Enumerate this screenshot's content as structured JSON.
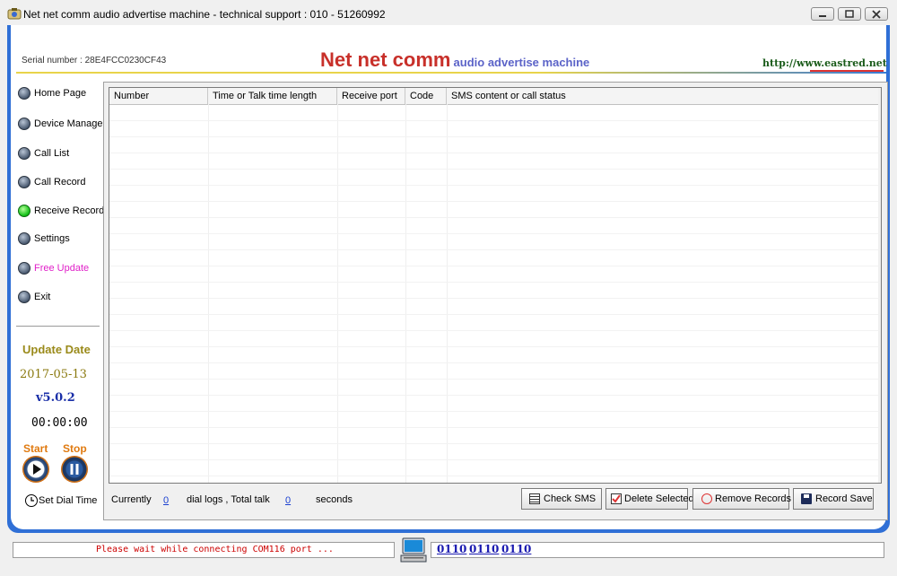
{
  "window": {
    "title": "Net net comm audio advertise machine - technical support : 010 - 51260992",
    "icons": [
      "app-icon",
      "minimize-icon",
      "maximize-icon",
      "close-icon"
    ]
  },
  "header": {
    "serial": "Serial number : 28E4FCC0230CF43",
    "brand_main": "Net net comm",
    "brand_sub": "audio advertise machine",
    "url": "http://www.eastred.net"
  },
  "sidebar": {
    "items": [
      {
        "label": "Home Page",
        "active": false
      },
      {
        "label": "Device Manager",
        "active": false
      },
      {
        "label": "Call List",
        "active": false
      },
      {
        "label": "Call Record",
        "active": false
      },
      {
        "label": "Receive Record",
        "active": true
      },
      {
        "label": "Settings",
        "active": false
      },
      {
        "label": "Free Update",
        "active": false
      },
      {
        "label": "Exit",
        "active": false
      }
    ],
    "update_label": "Update Date",
    "update_date": "2017-05-13",
    "version": "v5.0.2",
    "timer": "00:00:00",
    "start_label": "Start",
    "stop_label": "Stop",
    "set_dial_time": "Set Dial Time"
  },
  "table": {
    "columns": [
      "Number",
      "Time or Talk time length",
      "Receive port",
      "Code",
      "SMS content or call status"
    ],
    "rows": []
  },
  "footer": {
    "currently": "Currently",
    "dial_count": "0",
    "dial_logs_label": "dial logs ,  Total talk",
    "talk_count": "0",
    "seconds_label": "seconds",
    "buttons": {
      "check_sms": "Check SMS",
      "delete_selected": "Delete Selected",
      "remove_records": "Remove Records",
      "record_save": "Record Save"
    }
  },
  "status": {
    "message": "Please wait while connecting COM116 port ...",
    "ports": [
      "0110",
      "0110",
      "0110"
    ]
  },
  "colors": {
    "frame_blue": "#2f6fd6",
    "brand_red": "#c8302a",
    "brand_blue": "#5b63c8",
    "update_olive": "#9a8a1a",
    "version_blue": "#1a2fa8",
    "status_red": "#cc0000",
    "active_green": "#16c21a"
  }
}
